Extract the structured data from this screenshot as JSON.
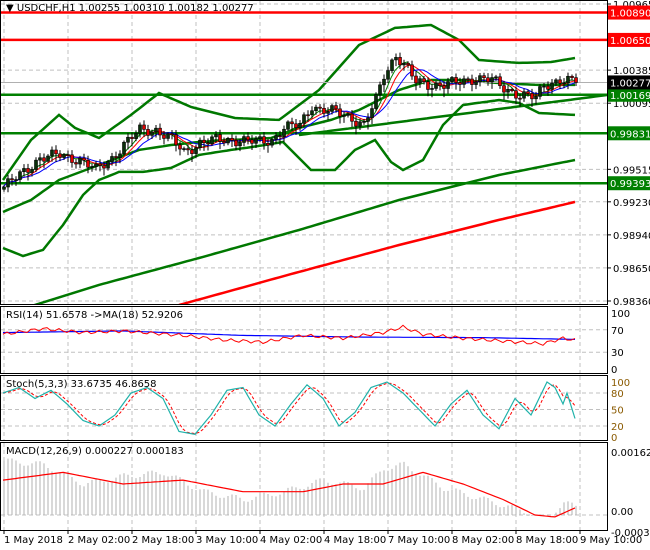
{
  "header": {
    "symbol": "USDCHF,H1",
    "open": "1.00255",
    "high": "1.00310",
    "low": "1.00182",
    "close": "1.00277"
  },
  "colors": {
    "bull": "#0a300a",
    "bear": "#e00000",
    "band": "#007800",
    "level_red": "#ff0000",
    "level_green": "#008000",
    "grid": "#c0c0c0"
  },
  "price_axis": {
    "ticks": [
      "1.00965",
      "1.00385",
      "1.00095",
      "0.99515",
      "0.99230",
      "0.98940",
      "0.98650",
      "0.98360"
    ],
    "range": [
      0.9836,
      1.00965
    ],
    "current_price": "1.00277",
    "levels": [
      {
        "value": "1.00890",
        "color": "#ff0000"
      },
      {
        "value": "1.00650",
        "color": "#ff0000"
      },
      {
        "value": "1.00169",
        "color": "#008000"
      },
      {
        "value": "0.99831",
        "color": "#008000"
      },
      {
        "value": "0.99393",
        "color": "#008000"
      }
    ]
  },
  "time_axis": {
    "labels": [
      "1 May 2018",
      "2 May 02:00",
      "2 May 18:00",
      "3 May 10:00",
      "4 May 02:00",
      "4 May 18:00",
      "7 May 10:00",
      "8 May 02:00",
      "8 May 18:00",
      "9 May 10:00"
    ],
    "bars_per_label": 16
  },
  "chart_data": {
    "type": "candlestick",
    "bars": 144,
    "close_path": [
      [
        0,
        0.9936
      ],
      [
        4,
        0.99465
      ],
      [
        9,
        0.99614
      ],
      [
        14,
        0.99641
      ],
      [
        19,
        0.99597
      ],
      [
        23,
        0.99509
      ],
      [
        27,
        0.99614
      ],
      [
        30,
        0.99728
      ],
      [
        34,
        0.9986
      ],
      [
        38,
        0.9986
      ],
      [
        42,
        0.99772
      ],
      [
        45,
        0.99667
      ],
      [
        49,
        0.99746
      ],
      [
        53,
        0.99772
      ],
      [
        58,
        0.99772
      ],
      [
        63,
        0.99755
      ],
      [
        67,
        0.99772
      ],
      [
        70,
        0.99877
      ],
      [
        74,
        0.99904
      ],
      [
        77,
        1.00079
      ],
      [
        79,
        1.00035
      ],
      [
        83,
        1.00018
      ],
      [
        87,
        0.99965
      ],
      [
        90,
        0.99904
      ],
      [
        93,
        1.00123
      ],
      [
        95,
        1.00342
      ],
      [
        98,
        1.00518
      ],
      [
        101,
        1.00386
      ],
      [
        103,
        1.00281
      ],
      [
        107,
        1.00255
      ],
      [
        110,
        1.00255
      ],
      [
        114,
        1.00281
      ],
      [
        118,
        1.00316
      ],
      [
        122,
        1.00298
      ],
      [
        125,
        1.00228
      ],
      [
        129,
        1.00167
      ],
      [
        133,
        1.00141
      ],
      [
        135,
        1.00255
      ],
      [
        139,
        1.00298
      ],
      [
        143,
        1.00277
      ]
    ],
    "bollinger_upper": [
      [
        0,
        0.99421
      ],
      [
        7,
        0.99772
      ],
      [
        14,
        0.99992
      ],
      [
        18,
        0.99878
      ],
      [
        24,
        0.9979
      ],
      [
        32,
        0.99992
      ],
      [
        39,
        1.00184
      ],
      [
        47,
        1.00062
      ],
      [
        58,
        0.99965
      ],
      [
        69,
        0.99948
      ],
      [
        79,
        1.00211
      ],
      [
        89,
        1.00605
      ],
      [
        98,
        1.00755
      ],
      [
        107,
        1.00781
      ],
      [
        114,
        1.00649
      ],
      [
        119,
        1.00474
      ],
      [
        129,
        1.00448
      ],
      [
        137,
        1.00456
      ],
      [
        143,
        1.00491
      ]
    ],
    "bollinger_middle": [
      [
        0,
        0.99141
      ],
      [
        7,
        0.99246
      ],
      [
        14,
        0.99421
      ],
      [
        24,
        0.99553
      ],
      [
        34,
        0.99685
      ],
      [
        42,
        0.99728
      ],
      [
        49,
        0.99755
      ],
      [
        57,
        0.99772
      ],
      [
        67,
        0.9979
      ],
      [
        74,
        0.99878
      ],
      [
        82,
        0.99948
      ],
      [
        89,
        1.00035
      ],
      [
        94,
        1.00123
      ],
      [
        99,
        1.00211
      ],
      [
        107,
        1.00298
      ],
      [
        114,
        1.00298
      ],
      [
        124,
        1.00272
      ],
      [
        134,
        1.00255
      ],
      [
        143,
        1.00255
      ]
    ],
    "bollinger_lower": [
      [
        0,
        0.98825
      ],
      [
        5,
        0.98755
      ],
      [
        10,
        0.98808
      ],
      [
        15,
        0.99027
      ],
      [
        20,
        0.9929
      ],
      [
        24,
        0.99421
      ],
      [
        29,
        0.99492
      ],
      [
        35,
        0.99492
      ],
      [
        42,
        0.99527
      ],
      [
        49,
        0.99641
      ],
      [
        57,
        0.99685
      ],
      [
        64,
        0.9972
      ],
      [
        70,
        0.99755
      ],
      [
        77,
        0.99509
      ],
      [
        83,
        0.99509
      ],
      [
        88,
        0.99685
      ],
      [
        93,
        0.99772
      ],
      [
        97,
        0.99579
      ],
      [
        100,
        0.99509
      ],
      [
        105,
        0.99597
      ],
      [
        110,
        0.99904
      ],
      [
        115,
        1.00079
      ],
      [
        124,
        1.00123
      ],
      [
        129,
        1.00097
      ],
      [
        134,
        1.00009
      ],
      [
        143,
        0.99992
      ]
    ],
    "ma_long_green": [
      [
        0,
        0.98238
      ],
      [
        24,
        0.98501
      ],
      [
        49,
        0.98737
      ],
      [
        74,
        0.98983
      ],
      [
        99,
        0.99246
      ],
      [
        124,
        0.99465
      ],
      [
        143,
        0.99597
      ]
    ],
    "ma_long_red": [
      [
        44,
        0.98325
      ],
      [
        74,
        0.98615
      ],
      [
        99,
        0.98851
      ],
      [
        124,
        0.99071
      ],
      [
        143,
        0.99229
      ]
    ],
    "trendline": [
      [
        74,
        0.99816
      ],
      [
        151,
        1.00167
      ]
    ]
  },
  "rsi": {
    "label": "RSI(14) 51.6578  ->MA(18) 52.9206",
    "levels": [
      "100",
      "70",
      "30",
      "0"
    ],
    "rsi": [
      [
        0,
        62
      ],
      [
        10,
        72
      ],
      [
        20,
        65
      ],
      [
        30,
        68
      ],
      [
        45,
        60
      ],
      [
        55,
        52
      ],
      [
        65,
        48
      ],
      [
        75,
        60
      ],
      [
        85,
        55
      ],
      [
        95,
        65
      ],
      [
        100,
        75
      ],
      [
        105,
        62
      ],
      [
        115,
        55
      ],
      [
        125,
        50
      ],
      [
        135,
        45
      ],
      [
        140,
        55
      ],
      [
        143,
        51.66
      ]
    ],
    "ma": [
      [
        0,
        65
      ],
      [
        30,
        68
      ],
      [
        60,
        60
      ],
      [
        90,
        57
      ],
      [
        120,
        56
      ],
      [
        143,
        52.92
      ]
    ]
  },
  "stoch": {
    "label": "Stoch(5,3,3) 33.6735 46.8658",
    "levels": [
      "100",
      "80",
      "50",
      "20",
      "0"
    ],
    "k": [
      [
        0,
        80
      ],
      [
        4,
        90
      ],
      [
        8,
        70
      ],
      [
        12,
        85
      ],
      [
        16,
        60
      ],
      [
        20,
        30
      ],
      [
        24,
        20
      ],
      [
        28,
        40
      ],
      [
        32,
        80
      ],
      [
        36,
        90
      ],
      [
        40,
        70
      ],
      [
        44,
        10
      ],
      [
        48,
        5
      ],
      [
        52,
        40
      ],
      [
        56,
        85
      ],
      [
        60,
        90
      ],
      [
        64,
        40
      ],
      [
        68,
        20
      ],
      [
        72,
        60
      ],
      [
        76,
        95
      ],
      [
        80,
        70
      ],
      [
        84,
        20
      ],
      [
        88,
        45
      ],
      [
        92,
        90
      ],
      [
        96,
        100
      ],
      [
        100,
        80
      ],
      [
        104,
        50
      ],
      [
        108,
        20
      ],
      [
        112,
        60
      ],
      [
        116,
        85
      ],
      [
        120,
        40
      ],
      [
        124,
        15
      ],
      [
        128,
        70
      ],
      [
        132,
        40
      ],
      [
        136,
        100
      ],
      [
        138,
        90
      ],
      [
        140,
        60
      ],
      [
        141,
        80
      ],
      [
        143,
        33.67
      ]
    ]
  },
  "macd": {
    "label": "MACD(12,26,9) 0.000227 0.000183",
    "levels": [
      "0.001625",
      "0.00",
      "-0.000304"
    ],
    "hist": [
      [
        0,
        0.0014
      ],
      [
        10,
        0.0013
      ],
      [
        20,
        0.0008
      ],
      [
        30,
        0.001
      ],
      [
        40,
        0.0011
      ],
      [
        50,
        0.0006
      ],
      [
        60,
        0.0004
      ],
      [
        70,
        0.0006
      ],
      [
        80,
        0.0009
      ],
      [
        90,
        0.0007
      ],
      [
        95,
        0.0012
      ],
      [
        100,
        0.0013
      ],
      [
        105,
        0.001
      ],
      [
        110,
        0.0007
      ],
      [
        120,
        0.0004
      ],
      [
        130,
        0.0001
      ],
      [
        135,
        -0.0001
      ],
      [
        140,
        0.0003
      ],
      [
        143,
        0.000227
      ]
    ],
    "signal": [
      [
        0,
        0.0009
      ],
      [
        15,
        0.0011
      ],
      [
        30,
        0.0008
      ],
      [
        45,
        0.0009
      ],
      [
        60,
        0.0006
      ],
      [
        75,
        0.0006
      ],
      [
        85,
        0.0008
      ],
      [
        95,
        0.0008
      ],
      [
        105,
        0.0011
      ],
      [
        115,
        0.0008
      ],
      [
        125,
        0.0004
      ],
      [
        133,
        0.0
      ],
      [
        138,
        -5e-05
      ],
      [
        143,
        0.000183
      ]
    ]
  }
}
